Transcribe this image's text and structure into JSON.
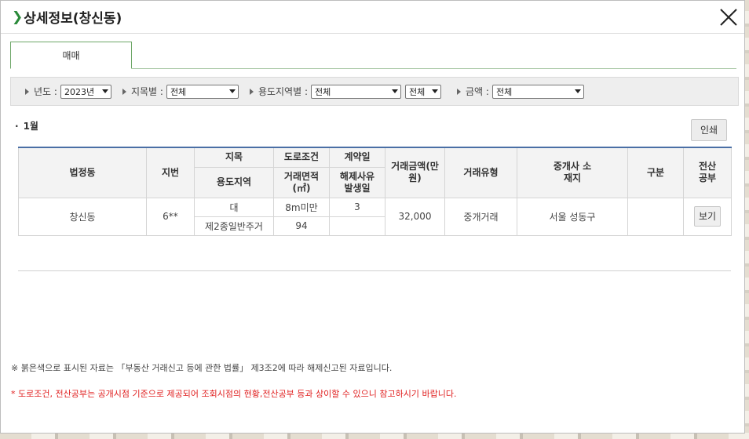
{
  "dialog": {
    "title_arrow": "❯",
    "title": "상세정보(창신동)",
    "close_label": "×"
  },
  "tabs": [
    {
      "label": "매매",
      "active": true
    }
  ],
  "filters": {
    "year_label": "년도 :",
    "year_value": "2023년",
    "jimok_label": "지목별 :",
    "jimok_value": "전체",
    "zone_label": "용도지역별 :",
    "zone_value": "전체",
    "zone_sub_value": "전체",
    "amount_label": "금액 :",
    "amount_value": "전체"
  },
  "month": {
    "dot": "·",
    "label": "1월"
  },
  "print_label": "인쇄",
  "table": {
    "headers": {
      "dong": "법정동",
      "jibun": "지번",
      "jimok": "지목",
      "road": "도로조건",
      "contract_day": "계약일",
      "price": "거래금액(만원)",
      "deal_type": "거래유형",
      "broker": "중개사 소재지",
      "gubun": "구분",
      "record": "전산 공부",
      "zone": "용도지역",
      "area": "거래면적(㎡)",
      "cancel": "해제사유 발생일"
    },
    "rows": [
      {
        "dong": "창신동",
        "jibun": "6**",
        "jimok": "대",
        "road": "8m미만",
        "contract_day": "3",
        "price": "32,000",
        "deal_type": "중개거래",
        "broker": "서울 성동구",
        "gubun": "",
        "zone": "제2종일반주거",
        "area": "94",
        "cancel": "",
        "view_label": "보기"
      }
    ]
  },
  "notes": {
    "note1": "※ 붉은색으로 표시된 자료는 「부동산 거래신고 등에 관한 법률」 제3조2에 따라 해제신고된 자료입니다.",
    "note2": "* 도로조건, 전산공부는 공개시점 기준으로 제공되어 조회시점의 현황,전산공부 등과 상이할 수 있으니 참고하시기 바랍니다."
  },
  "colors": {
    "accent_green": "#2a8a3a",
    "table_top_border": "#4a6fa5",
    "note_red": "#e02020"
  }
}
